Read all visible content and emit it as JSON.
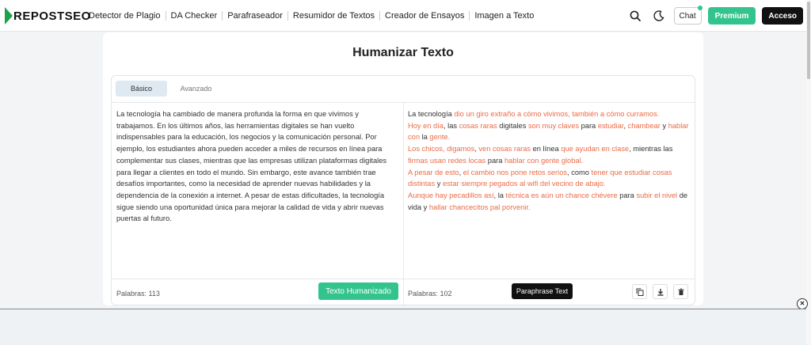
{
  "brand": {
    "logo_text": "REPOSTSEO",
    "accent": "#1aa34a"
  },
  "nav": [
    "Detector de Plagio",
    "DA Checker",
    "Parafraseador",
    "Resumidor de Textos",
    "Creador de Ensayos",
    "Imagen a Texto"
  ],
  "header": {
    "search_icon": "search-icon",
    "theme_icon": "moon-icon",
    "chat_label": "Chat",
    "premium_label": "Premium",
    "premium_color": "#33c48d",
    "acceso_label": "Acceso"
  },
  "page": {
    "title": "Humanizar Texto"
  },
  "tabs": [
    {
      "label": "Básico",
      "active": true
    },
    {
      "label": "Avanzado",
      "active": false
    }
  ],
  "input": {
    "text": "La tecnología ha cambiado de manera profunda la forma en que vivimos y trabajamos. En los últimos años, las herramientas digitales se han vuelto indispensables para la educación, los negocios y la comunicación personal. Por ejemplo, los estudiantes ahora pueden acceder a miles de recursos en línea para complementar sus clases, mientras que las empresas utilizan plataformas digitales para llegar a clientes en todo el mundo. Sin embargo, este avance también trae desafíos importantes, como la necesidad de aprender nuevas habilidades y la dependencia de la conexión a internet. A pesar de estas dificultades, la tecnología sigue siendo una oportunidad única para mejorar la calidad de vida y abrir nuevas puertas al futuro.",
    "word_count": "Palabras: 113",
    "action_label": "Texto Humanizado",
    "action_color": "#33c48d"
  },
  "output": {
    "highlight_color": "#ec6b46",
    "lines": [
      [
        {
          "t": "La tecnología ",
          "h": false
        },
        {
          "t": "dio un giro extraño a cómo vivimos, también a cómo curramos.",
          "h": true
        }
      ],
      [
        {
          "t": "Hoy en día",
          "h": true
        },
        {
          "t": ", las ",
          "h": false
        },
        {
          "t": "cosas raras",
          "h": true
        },
        {
          "t": " digitales ",
          "h": false
        },
        {
          "t": "son muy claves",
          "h": true
        },
        {
          "t": " para ",
          "h": false
        },
        {
          "t": "estudiar",
          "h": true
        },
        {
          "t": ", ",
          "h": false
        },
        {
          "t": "chambear",
          "h": true
        },
        {
          "t": " y ",
          "h": false
        },
        {
          "t": "hablar con",
          "h": true
        },
        {
          "t": " la ",
          "h": false
        },
        {
          "t": "gente.",
          "h": true
        }
      ],
      [
        {
          "t": "Los chicos, digamos",
          "h": true
        },
        {
          "t": ", ",
          "h": false
        },
        {
          "t": "ven cosas raras",
          "h": true
        },
        {
          "t": " en línea ",
          "h": false
        },
        {
          "t": "que ayudan en clase",
          "h": true
        },
        {
          "t": ", mientras las ",
          "h": false
        },
        {
          "t": "firmas usan redes locas",
          "h": true
        },
        {
          "t": " para ",
          "h": false
        },
        {
          "t": "hablar con gente global.",
          "h": true
        }
      ],
      [
        {
          "t": "A pesar de esto",
          "h": true
        },
        {
          "t": ", ",
          "h": false
        },
        {
          "t": "el cambio nos pone retos serios",
          "h": true
        },
        {
          "t": ", como ",
          "h": false
        },
        {
          "t": "tener que estudiar cosas distintas",
          "h": true
        },
        {
          "t": " y ",
          "h": false
        },
        {
          "t": "estar siempre pegados al wifi del vecino de abajo.",
          "h": true
        }
      ],
      [
        {
          "t": "Aunque hay pecadillos así",
          "h": true
        },
        {
          "t": ", la ",
          "h": false
        },
        {
          "t": "técnica es aún un chance chévere",
          "h": true
        },
        {
          "t": " para ",
          "h": false
        },
        {
          "t": "subir el nivel",
          "h": true
        },
        {
          "t": " de vida y ",
          "h": false
        },
        {
          "t": "hallar chancecitos pal porvenir.",
          "h": true
        }
      ]
    ],
    "word_count": "Palabras: 102",
    "paraphrase_label": "Paraphrase Text",
    "actions": [
      "copy-icon",
      "download-icon",
      "trash-icon"
    ]
  },
  "overlay": {
    "close_glyph": "✕"
  }
}
